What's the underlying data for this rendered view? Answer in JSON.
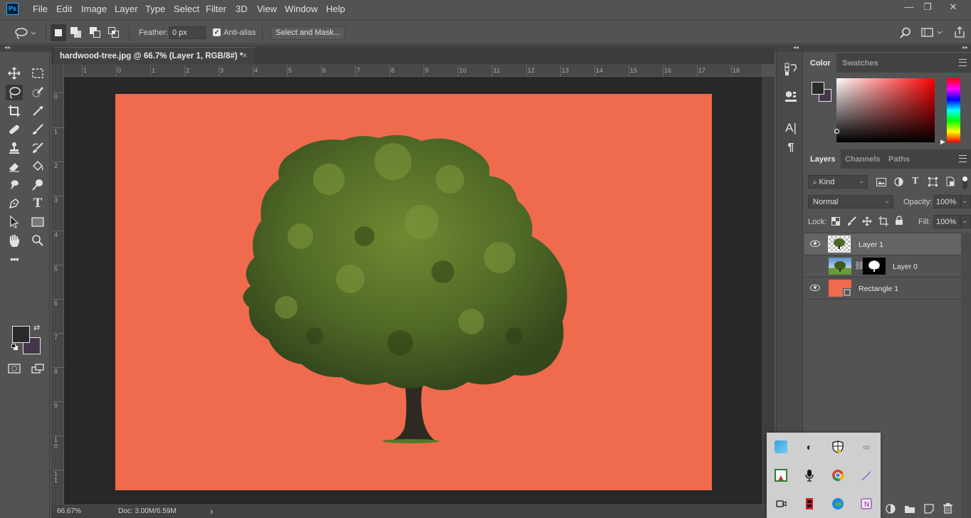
{
  "app": {
    "logo": "Ps",
    "name": "Adobe Photoshop"
  },
  "menu": [
    "File",
    "Edit",
    "Image",
    "Layer",
    "Type",
    "Select",
    "Filter",
    "3D",
    "View",
    "Window",
    "Help"
  ],
  "window_controls": {
    "minimize": "—",
    "restore": "❐",
    "close": "✕"
  },
  "options_bar": {
    "tool": "lasso",
    "feather_label": "Feather:",
    "feather_value": "0 px",
    "anti_alias_label": "Anti-alias",
    "anti_alias_checked": true,
    "select_and_mask_label": "Select and Mask..."
  },
  "document": {
    "tab_title": "hardwood-tree.jpg @ 66.7% (Layer 1, RGB/8#) *",
    "close_glyph": "✕",
    "canvas_color": "#f06b4e",
    "ruler_h_ticks": [
      "1",
      "0",
      "1",
      "2",
      "3",
      "4",
      "5",
      "6",
      "7",
      "8",
      "9",
      "10",
      "11",
      "12",
      "13",
      "14",
      "15",
      "16",
      "17",
      "18"
    ],
    "ruler_v_ticks": [
      "0",
      "1",
      "2",
      "3",
      "4",
      "5",
      "6",
      "7",
      "8",
      "9",
      "1 0",
      "1 1"
    ]
  },
  "tools": [
    [
      "move-tool",
      "rectangular-marquee-tool"
    ],
    [
      "lasso-tool",
      "quick-selection-tool"
    ],
    [
      "crop-tool",
      "eyedropper-tool"
    ],
    [
      "spot-healing-tool",
      "brush-tool"
    ],
    [
      "clone-stamp-tool",
      "history-brush-tool"
    ],
    [
      "eraser-tool",
      "paint-bucket-tool"
    ],
    [
      "blur-tool",
      "dodge-tool"
    ],
    [
      "pen-tool",
      "type-tool"
    ],
    [
      "path-selection-tool",
      "rectangle-tool"
    ],
    [
      "hand-tool",
      "zoom-tool"
    ],
    [
      "edit-toolbar"
    ]
  ],
  "colors": {
    "foreground": "#2a2a2a",
    "background": "#45364a"
  },
  "status": {
    "zoom": "66.67%",
    "doc": "Doc: 3.00M/6.59M",
    "arrow": "›"
  },
  "color_panel": {
    "tabs": [
      "Color",
      "Swatches"
    ],
    "active": "Color"
  },
  "layers_panel": {
    "tabs": [
      "Layers",
      "Channels",
      "Paths"
    ],
    "active": "Layers",
    "filter_label": "Kind",
    "blend_mode": "Normal",
    "opacity_label": "Opacity:",
    "opacity_value": "100%",
    "lock_label": "Lock:",
    "fill_label": "Fill:",
    "fill_value": "100%",
    "layers": [
      {
        "name": "Layer 1",
        "visible": true,
        "selected": true
      },
      {
        "name": "Layer 0",
        "visible": false,
        "selected": false,
        "has_mask": true
      },
      {
        "name": "Rectangle 1",
        "visible": true,
        "selected": false
      }
    ]
  },
  "system_tray": [
    "network-app-icon",
    "speaker-app-icon",
    "windows-security-icon",
    "creative-cloud-icon",
    "adobe-acrobat-icon",
    "microphone-icon",
    "chrome-icon",
    "pen-app-icon",
    "meet-now-icon",
    "video-app-icon",
    "edge-icon",
    "onenote-icon"
  ]
}
